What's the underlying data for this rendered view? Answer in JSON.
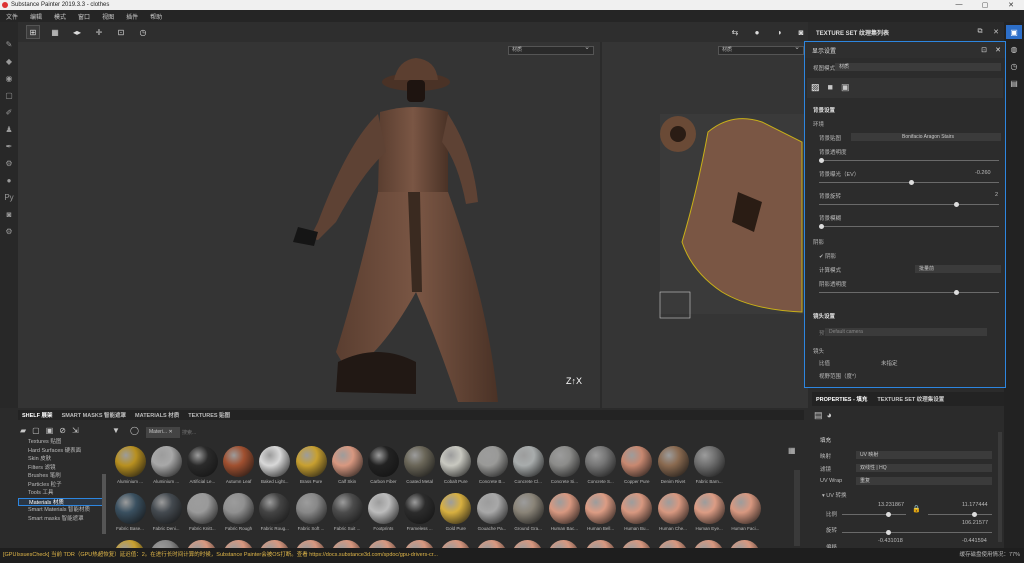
{
  "app": {
    "title": "Substance Painter 2019.3.3 - clothes",
    "menus": [
      "文件",
      "编辑",
      "模式",
      "窗口",
      "视图",
      "插件",
      "帮助"
    ],
    "window_controls": [
      "—",
      "▢",
      "✕"
    ]
  },
  "viewports": {
    "left_select": "材质",
    "right_select": "材质"
  },
  "texture_set_panel": {
    "title": "TEXTURE SET 纹理集列表"
  },
  "display_settings": {
    "title": "显示设置",
    "view_mode_label": "视图模式",
    "view_mode_value": "材质",
    "section_bg": "背景设置",
    "env_label": "环境",
    "env_map_label": "背景贴图",
    "env_map_value": "Bonifacio Aragon Stairs",
    "opacity_label": "背景透明度",
    "exposure_label": "背景曝光（EV）",
    "exposure_value": "-0.260",
    "rotation_label": "背景旋转",
    "rotation_value": "2",
    "blur_label": "背景模糊",
    "shadow_section": "阴影",
    "shadow_checkbox": "阴影",
    "calc_mode_label": "计算模式",
    "calc_mode_value": "批量前",
    "shadow_opacity_label": "阴影透明度",
    "camera_section": "镜头设置",
    "preset_label": "预设",
    "preset_value": "Default camera",
    "lens_label": "镜头",
    "ratio_label": "比值",
    "ratio_value": "未指定",
    "fov_label": "视野范围（度*）"
  },
  "shelf": {
    "tabs": [
      "SHELF 展架",
      "SMART MASKS 智能遮罩",
      "MATERIALS 材质",
      "TEXTURES 贴图"
    ],
    "filter_chip": "Materi...",
    "search_placeholder": "搜索...",
    "categories": [
      "Textures 贴图",
      "Hard Surfaces 硬表面",
      "Skin 皮肤",
      "Filters 滤镜",
      "Brushes 笔刷",
      "Particles 粒子",
      "Tools 工具",
      "Materials 材质",
      "Smart Materials 智能材质",
      "Smart masks 智能遮罩"
    ],
    "selected_category": "Materials 材质",
    "row1": [
      {
        "name": "Aluminium ...",
        "color": "#b89020"
      },
      {
        "name": "Aluminium ...",
        "color": "#a8a8a8"
      },
      {
        "name": "Artificial Le...",
        "color": "#2a2a2a"
      },
      {
        "name": "Autumn Leaf",
        "color": "#a05030"
      },
      {
        "name": "Baked Light...",
        "color": "#d8d8d8"
      },
      {
        "name": "Brass Pure",
        "color": "#c8a030"
      },
      {
        "name": "Calf Skin",
        "color": "#d89880"
      },
      {
        "name": "Carbon Fiber",
        "color": "#222222"
      },
      {
        "name": "Coated Metal",
        "color": "#6a6658"
      },
      {
        "name": "Cobalt Pure",
        "color": "#c8c8c0"
      },
      {
        "name": "Concrete B...",
        "color": "#9a9a98"
      },
      {
        "name": "Concrete Cl...",
        "color": "#a8acac"
      },
      {
        "name": "Concrete Si...",
        "color": "#8c8c8a"
      },
      {
        "name": "Concrete S...",
        "color": "#767676"
      },
      {
        "name": "Copper Pure",
        "color": "#c88870"
      },
      {
        "name": "Denim Rivet",
        "color": "#8a6a50"
      },
      {
        "name": "Fabric Barn...",
        "color": "#707070"
      }
    ],
    "row2": [
      {
        "name": "Fabric Base...",
        "color": "#3a5060"
      },
      {
        "name": "Fabric Deni...",
        "color": "#444a50"
      },
      {
        "name": "Fabric Knitt...",
        "color": "#9a9a9a"
      },
      {
        "name": "Fabric Rough",
        "color": "#909090"
      },
      {
        "name": "Fabric Roug...",
        "color": "#444444"
      },
      {
        "name": "Fabric Soft ...",
        "color": "#888888"
      },
      {
        "name": "Fabric Suit ...",
        "color": "#4c4c4c"
      },
      {
        "name": "Footprints",
        "color": "#bcbcbc"
      },
      {
        "name": "Frameless ...",
        "color": "#2c2c2c"
      },
      {
        "name": "Gold Pure",
        "color": "#d8b040"
      },
      {
        "name": "Gouache Pa...",
        "color": "#a8a8a8"
      },
      {
        "name": "Ground Gra...",
        "color": "#8a8478"
      },
      {
        "name": "Human Bac...",
        "color": "#d89880"
      },
      {
        "name": "Human Bell...",
        "color": "#dc9c84"
      },
      {
        "name": "Human Bu...",
        "color": "#d89880"
      },
      {
        "name": "Human Che...",
        "color": "#d89880"
      },
      {
        "name": "Human Eye...",
        "color": "#dc9c84"
      },
      {
        "name": "Human Faci...",
        "color": "#d89880"
      }
    ]
  },
  "properties": {
    "tabs": [
      "PROPERTIES - 填充",
      "TEXTURE SET 纹理集设置"
    ],
    "section": "填充",
    "mapping_label": "映射",
    "mapping_value": "UV 映射",
    "filter_label": "滤镜",
    "filter_value": "双线性 | HQ",
    "wrap_label": "UV Wrap",
    "wrap_value": "重复",
    "uv_transform": "UV 转换",
    "scale_label": "比例",
    "scale_x": "13.231867",
    "scale_y": "11.177444",
    "rotate_label": "旋转",
    "rotate_value": "106.21577",
    "offset_label": "偏移",
    "offset_x": "-0.431018",
    "offset_y": "-0.441594"
  },
  "status": {
    "text": "[GPUIssuesCheck] 当前 TDR（GPU热超恢复）延迟值：2。在进行长时间计算的时候，Substance Painter会被OS打断。查看 https://docs.substance3d.com/spdoc/gpu-drivers-cr...",
    "memory": "缓存磁盘使用情况：77%"
  }
}
